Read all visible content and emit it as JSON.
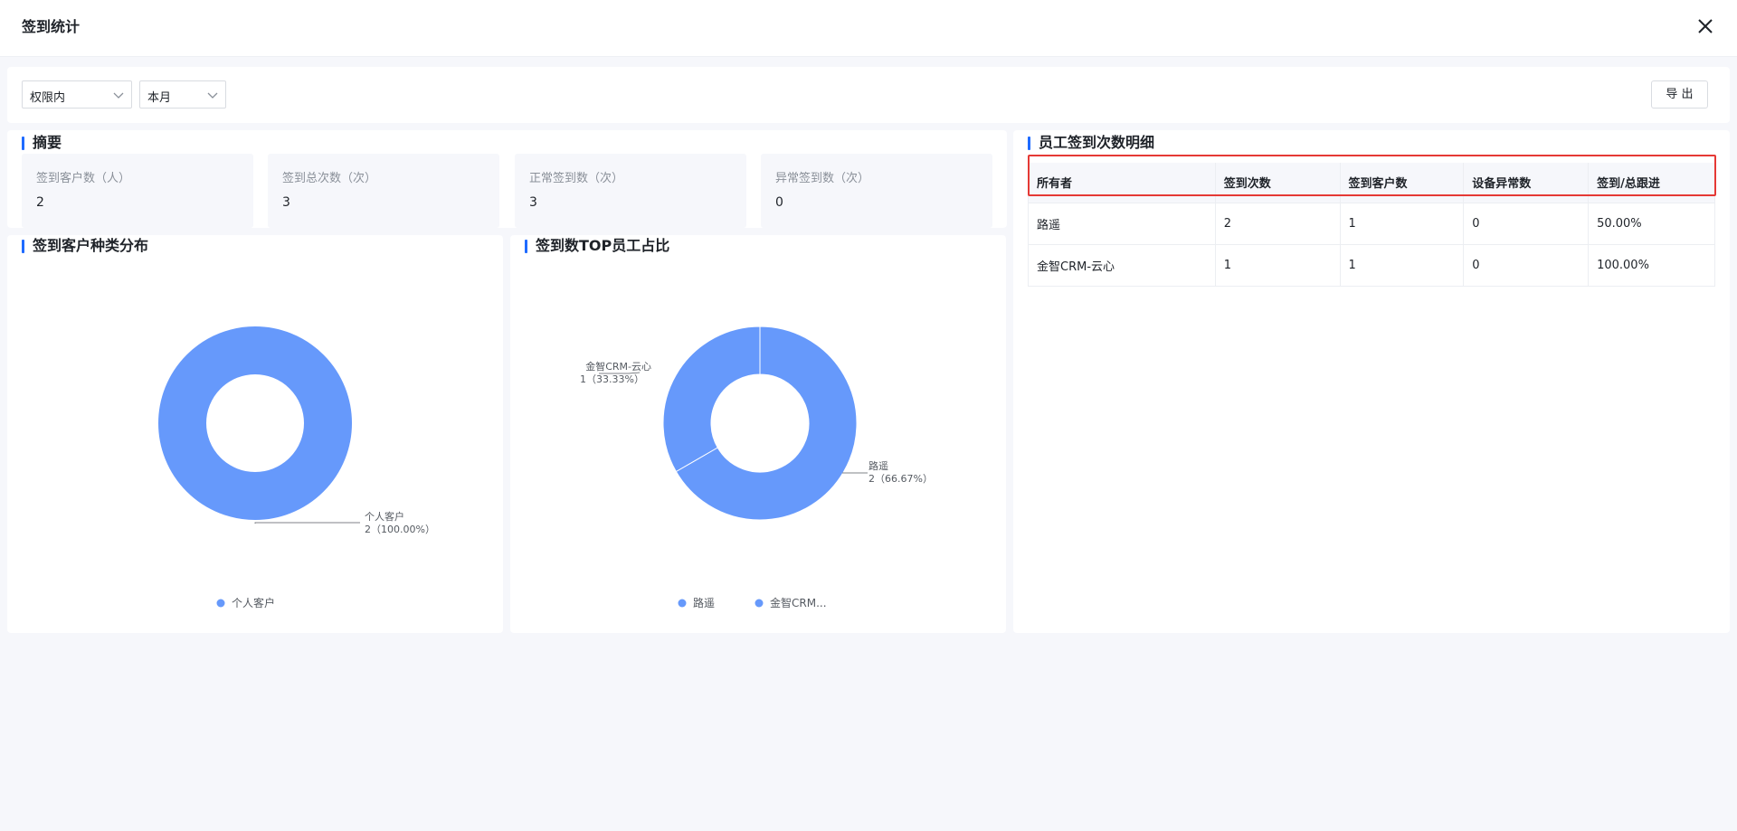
{
  "header": {
    "title": "签到统计"
  },
  "filters": {
    "scope": "权限内",
    "period": "本月",
    "export_label": "导 出"
  },
  "summary": {
    "title": "摘要",
    "cards": [
      {
        "label": "签到客户数（人）",
        "value": "2"
      },
      {
        "label": "签到总次数（次）",
        "value": "3"
      },
      {
        "label": "正常签到数（次）",
        "value": "3"
      },
      {
        "label": "异常签到数（次）",
        "value": "0"
      }
    ]
  },
  "customer_chart": {
    "title": "签到客户种类分布",
    "legend": [
      "个人客户"
    ],
    "callouts": [
      {
        "name": "个人客户",
        "detail": "2（100.00%）"
      }
    ]
  },
  "top_chart": {
    "title": "签到数TOP员工占比",
    "legend": [
      "路遥",
      "金智CRM..."
    ],
    "callouts": [
      {
        "name": "金智CRM-云心",
        "detail": "1（33.33%）"
      },
      {
        "name": "路遥",
        "detail": "2（66.67%）"
      }
    ]
  },
  "detail_table": {
    "title": "员工签到次数明细",
    "columns": [
      "所有者",
      "签到次数",
      "签到客户数",
      "设备异常数",
      "签到/总跟进"
    ],
    "rows": [
      [
        "路遥",
        "2",
        "1",
        "0",
        "50.00%"
      ],
      [
        "金智CRM-云心",
        "1",
        "1",
        "0",
        "100.00%"
      ]
    ]
  },
  "colors": {
    "accent": "#1f6bff",
    "pie_fill": "#6699fb",
    "highlight": "#e53935"
  },
  "chart_data": [
    {
      "type": "pie",
      "title": "签到客户种类分布",
      "categories": [
        "个人客户"
      ],
      "values": [
        2
      ],
      "percentages": [
        100.0
      ],
      "legend": "bottom"
    },
    {
      "type": "pie",
      "title": "签到数TOP员工占比",
      "categories": [
        "路遥",
        "金智CRM-云心"
      ],
      "values": [
        2,
        1
      ],
      "percentages": [
        66.67,
        33.33
      ],
      "legend": "bottom"
    }
  ]
}
